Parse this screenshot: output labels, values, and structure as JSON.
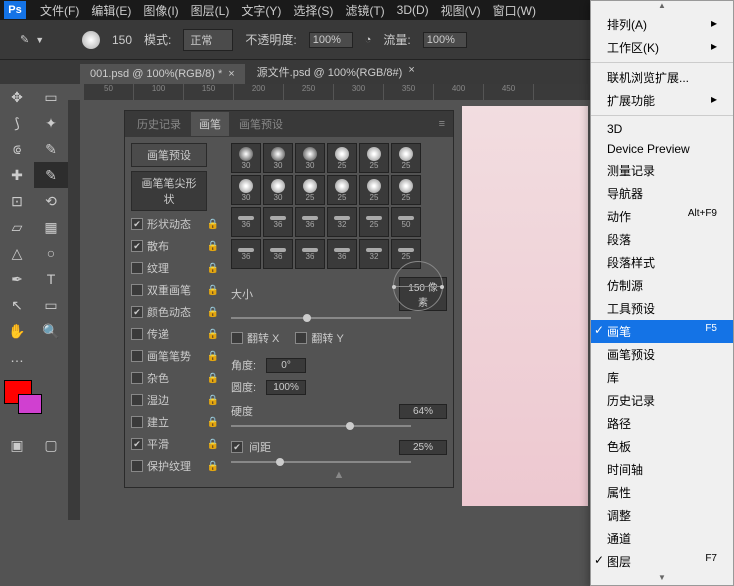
{
  "menubar": [
    "文件(F)",
    "编辑(E)",
    "图像(I)",
    "图层(L)",
    "文字(Y)",
    "选择(S)",
    "滤镜(T)",
    "3D(D)",
    "视图(V)",
    "窗口(W)"
  ],
  "logo": "Ps",
  "toolbar": {
    "brush_size": "150",
    "mode_label": "模式:",
    "mode_value": "正常",
    "opacity_label": "不透明度:",
    "opacity_value": "100%",
    "flow_label": "流量:",
    "flow_value": "100%"
  },
  "tabs": [
    {
      "title": "001.psd @ 100%(RGB/8) *"
    },
    {
      "title": "源文件.psd @ 100%(RGB/8#)"
    }
  ],
  "ruler_marks": [
    "50",
    "100",
    "150",
    "200",
    "250",
    "300",
    "350",
    "400",
    "450"
  ],
  "panel": {
    "tabs": [
      "历史记录",
      "画笔",
      "画笔预设"
    ],
    "preset_btn": "画笔预设",
    "tip_shape": "画笔笔尖形状",
    "options": [
      {
        "label": "形状动态",
        "checked": true,
        "lock": true
      },
      {
        "label": "散布",
        "checked": true,
        "lock": true
      },
      {
        "label": "纹理",
        "checked": false,
        "lock": true
      },
      {
        "label": "双重画笔",
        "checked": false,
        "lock": true
      },
      {
        "label": "颜色动态",
        "checked": true,
        "lock": true
      },
      {
        "label": "传递",
        "checked": false,
        "lock": true
      },
      {
        "label": "画笔笔势",
        "checked": false,
        "lock": true
      },
      {
        "label": "杂色",
        "checked": false,
        "lock": true
      },
      {
        "label": "湿边",
        "checked": false,
        "lock": true
      },
      {
        "label": "建立",
        "checked": false,
        "lock": true
      },
      {
        "label": "平滑",
        "checked": true,
        "lock": true
      },
      {
        "label": "保护纹理",
        "checked": false,
        "lock": true
      }
    ],
    "tip_sizes": [
      "30",
      "30",
      "30",
      "25",
      "25",
      "25",
      "30",
      "30",
      "25",
      "25",
      "25",
      "25",
      "36",
      "36",
      "36",
      "32",
      "25",
      "50",
      "36",
      "36",
      "36",
      "36",
      "32",
      "25"
    ],
    "size_label": "大小",
    "size_value": "150 像素",
    "flip_x": "翻转 X",
    "flip_y": "翻转 Y",
    "angle_label": "角度:",
    "angle_value": "0°",
    "round_label": "圆度:",
    "round_value": "100%",
    "hard_label": "硬度",
    "hard_value": "64%",
    "spacing_label": "间距",
    "spacing_value": "25%"
  },
  "dropdown": {
    "groups": [
      [
        {
          "label": "排列(A)",
          "arrow": true
        },
        {
          "label": "工作区(K)",
          "arrow": true
        }
      ],
      [
        {
          "label": "联机浏览扩展..."
        },
        {
          "label": "扩展功能",
          "arrow": true
        }
      ],
      [
        {
          "label": "3D"
        },
        {
          "label": "Device Preview"
        },
        {
          "label": "测量记录"
        },
        {
          "label": "导航器"
        },
        {
          "label": "动作",
          "shortcut": "Alt+F9"
        },
        {
          "label": "段落"
        },
        {
          "label": "段落样式"
        },
        {
          "label": "仿制源"
        },
        {
          "label": "工具预设"
        },
        {
          "label": "画笔",
          "shortcut": "F5",
          "checked": true,
          "highlight": true
        },
        {
          "label": "画笔预设"
        },
        {
          "label": "库"
        },
        {
          "label": "历史记录"
        },
        {
          "label": "路径"
        },
        {
          "label": "色板"
        },
        {
          "label": "时间轴"
        },
        {
          "label": "属性"
        },
        {
          "label": "调整"
        },
        {
          "label": "通道"
        },
        {
          "label": "图层",
          "shortcut": "F7",
          "checked": true
        }
      ]
    ]
  }
}
